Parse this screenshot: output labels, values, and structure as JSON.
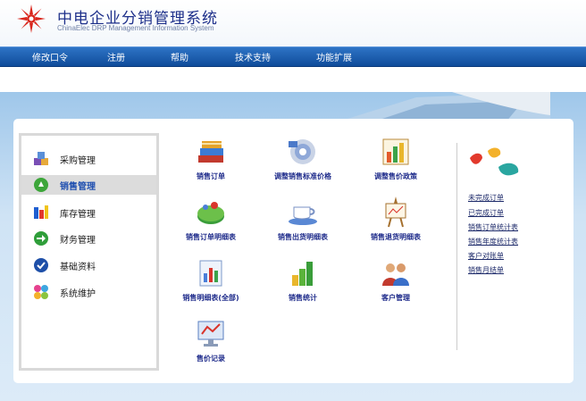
{
  "header": {
    "title": "中电企业分销管理系统",
    "subtitle": "ChinaElec DRP Management Information System"
  },
  "nav": [
    "修改口令",
    "注册",
    "帮助",
    "技术支持",
    "功能扩展"
  ],
  "side_menu": [
    {
      "label": "采购管理",
      "icon": "boxes-icon"
    },
    {
      "label": "销售管理",
      "icon": "sales-icon",
      "active": true
    },
    {
      "label": "库存管理",
      "icon": "inventory-icon"
    },
    {
      "label": "财务管理",
      "icon": "arrow-circle-icon"
    },
    {
      "label": "基础资料",
      "icon": "check-icon"
    },
    {
      "label": "系统维护",
      "icon": "puzzle-icon"
    }
  ],
  "tiles": [
    {
      "label": "销售订单",
      "icon": "books-icon"
    },
    {
      "label": "调整销售标准价格",
      "icon": "disc-icon"
    },
    {
      "label": "调整售价政策",
      "icon": "chart-icon"
    },
    {
      "label": "销售订单明细表",
      "icon": "pie-icon"
    },
    {
      "label": "销售出货明细表",
      "icon": "cup-icon"
    },
    {
      "label": "销售退货明细表",
      "icon": "easel-icon"
    },
    {
      "label": "销售明细表(全部)",
      "icon": "report-icon"
    },
    {
      "label": "销售统计",
      "icon": "bar-chart-icon"
    },
    {
      "label": "客户管理",
      "icon": "people-icon"
    },
    {
      "label": "售价记录",
      "icon": "monitor-chart-icon"
    }
  ],
  "quick_links": [
    "未完成订单",
    "已完成订单",
    "销售订单统计表",
    "销售年度统计表",
    "客户对账单",
    "销售月结单"
  ],
  "colors": {
    "nav": "#0f4b9a",
    "accent": "#1d2a8a",
    "panel_bg": "#cfe3f5"
  }
}
